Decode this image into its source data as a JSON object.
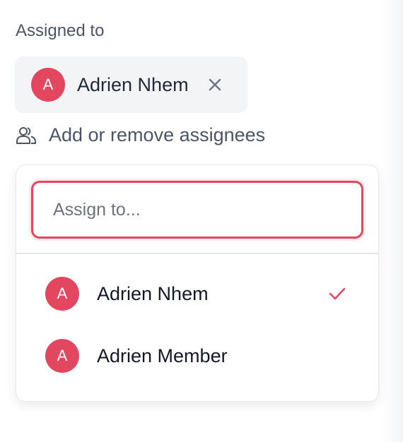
{
  "assigned": {
    "label": "Assigned to",
    "chip": {
      "initial": "A",
      "name": "Adrien Nhem",
      "remove_icon": "close-icon"
    }
  },
  "add_assignees": {
    "icon": "users-icon",
    "label": "Add or remove assignees"
  },
  "dropdown": {
    "search_placeholder": "Assign to...",
    "search_value": "",
    "options": [
      {
        "initial": "A",
        "name": "Adrien Nhem",
        "selected": true
      },
      {
        "initial": "A",
        "name": "Adrien Member",
        "selected": false
      }
    ]
  },
  "colors": {
    "accent": "#e2475f",
    "chip_bg": "#f3f4f6",
    "muted_text": "#4b5563"
  }
}
